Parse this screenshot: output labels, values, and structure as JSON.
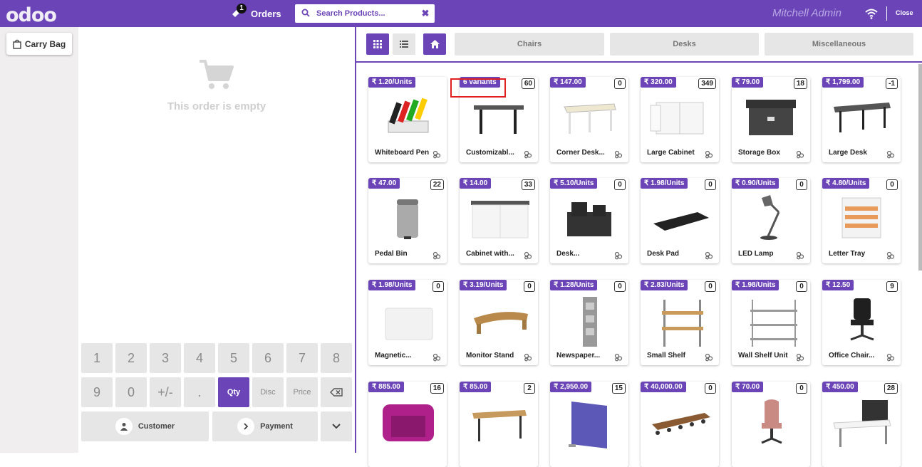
{
  "header": {
    "logo": "odoo",
    "orders_label": "Orders",
    "orders_count": "1",
    "search_placeholder": "Search Products...",
    "user": "Mitchell Admin",
    "close_label": "Close"
  },
  "left": {
    "carry_bag": "Carry Bag"
  },
  "order": {
    "empty_text": "This order is empty"
  },
  "numpad": {
    "keys": [
      "1",
      "2",
      "3",
      "4",
      "5",
      "6",
      "7",
      "8",
      "9",
      "0",
      "+/-",
      ".",
      "Qty",
      "Disc",
      "Price"
    ],
    "customer": "Customer",
    "payment": "Payment"
  },
  "categories": [
    "Chairs",
    "Desks",
    "Miscellaneous"
  ],
  "products": [
    {
      "price": "₹ 1.20/Units",
      "qty": "",
      "name": "Whiteboard Pen",
      "icon": "whiteboard-pen-image"
    },
    {
      "price": "6 variants",
      "qty": "60",
      "name": "Customizabl...",
      "icon": "desk-image"
    },
    {
      "price": "₹ 147.00",
      "qty": "0",
      "name": "Corner Desk...",
      "icon": "corner-desk-image"
    },
    {
      "price": "₹ 320.00",
      "qty": "349",
      "name": "Large Cabinet",
      "icon": "cabinet-image"
    },
    {
      "price": "₹ 79.00",
      "qty": "18",
      "name": "Storage Box",
      "icon": "storage-box-image"
    },
    {
      "price": "₹ 1,799.00",
      "qty": "-1",
      "name": "Large Desk",
      "icon": "large-desk-image"
    },
    {
      "price": "₹ 47.00",
      "qty": "22",
      "name": "Pedal Bin",
      "icon": "pedal-bin-image"
    },
    {
      "price": "₹ 14.00",
      "qty": "33",
      "name": "Cabinet with...",
      "icon": "cabinet-doors-image"
    },
    {
      "price": "₹ 5.10/Units",
      "qty": "0",
      "name": "Desk...",
      "icon": "desk-organizer-image"
    },
    {
      "price": "₹ 1.98/Units",
      "qty": "0",
      "name": "Desk Pad",
      "icon": "desk-pad-image"
    },
    {
      "price": "₹ 0.90/Units",
      "qty": "0",
      "name": "LED Lamp",
      "icon": "lamp-image"
    },
    {
      "price": "₹ 4.80/Units",
      "qty": "0",
      "name": "Letter Tray",
      "icon": "letter-tray-image"
    },
    {
      "price": "₹ 1.98/Units",
      "qty": "0",
      "name": "Magnetic...",
      "icon": "magnetic-board-image"
    },
    {
      "price": "₹ 3.19/Units",
      "qty": "0",
      "name": "Monitor Stand",
      "icon": "monitor-stand-image"
    },
    {
      "price": "₹ 1.28/Units",
      "qty": "0",
      "name": "Newspaper...",
      "icon": "newspaper-rack-image"
    },
    {
      "price": "₹ 2.83/Units",
      "qty": "0",
      "name": "Small Shelf",
      "icon": "small-shelf-image"
    },
    {
      "price": "₹ 1.98/Units",
      "qty": "0",
      "name": "Wall Shelf Unit",
      "icon": "wall-shelf-image"
    },
    {
      "price": "₹ 12.50",
      "qty": "9",
      "name": "Office Chair...",
      "icon": "office-chair-image"
    },
    {
      "price": "₹ 885.00",
      "qty": "16",
      "name": "",
      "icon": "booth-image"
    },
    {
      "price": "₹ 85.00",
      "qty": "2",
      "name": "",
      "icon": "table-image"
    },
    {
      "price": "₹ 2,950.00",
      "qty": "15",
      "name": "",
      "icon": "partition-image"
    },
    {
      "price": "₹ 40,000.00",
      "qty": "0",
      "name": "",
      "icon": "conference-table-image"
    },
    {
      "price": "₹ 70.00",
      "qty": "0",
      "name": "",
      "icon": "chair-image"
    },
    {
      "price": "₹ 450.00",
      "qty": "28",
      "name": "",
      "icon": "workstation-image"
    }
  ],
  "colors": {
    "brand": "#6b45b8",
    "highlight": "#e02020"
  }
}
